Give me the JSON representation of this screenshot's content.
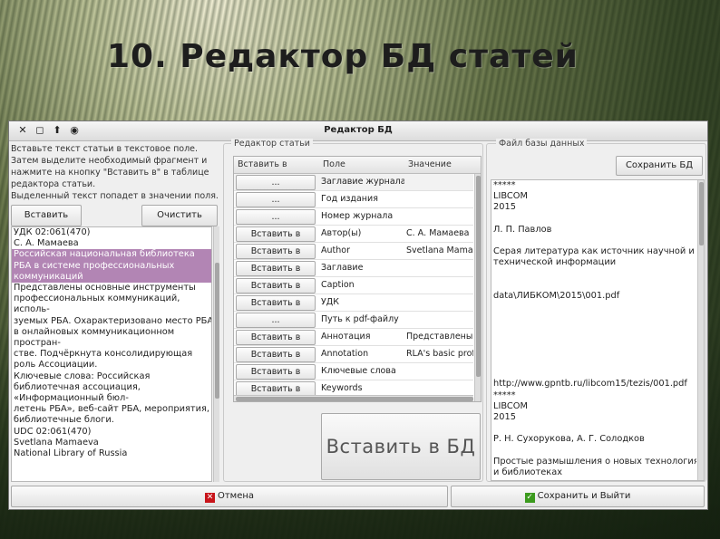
{
  "slide": {
    "title": "10. Редактор БД статей"
  },
  "window": {
    "title": "Редактор БД",
    "controls": [
      "✕",
      "◻",
      "⬆",
      "◉"
    ]
  },
  "left": {
    "instructions": [
      "Вставьте текст статьи в текстовое поле.",
      "Затем выделите необходимый фрагмент и",
      "нажмите на кнопку \"Вставить в\" в таблице",
      "редактора статьи.",
      "Выделенный текст попадет в значении поля."
    ],
    "insert_label": "Вставить",
    "clear_label": "Очистить",
    "text_lines": [
      "УДК 02:061(470)",
      "С. А. Мамаева",
      "Российская национальная библиотека",
      "РБА в системе профессиональных",
      "коммуникаций",
      "Представлены основные инструменты",
      "профессиональных коммуникаций,",
      "исполь-",
      "зуемых РБА. Охарактеризовано место РБА",
      "в онлайновых коммуникационном",
      "простран-",
      "стве. Подчёркнута консолидирующая",
      "роль Ассоциации.",
      "Ключевые слова: Российская",
      "библиотечная ассоциация,",
      "«Информационный бюл-",
      "летень РБА», веб-сайт РБА, мероприятия,",
      "библиотечные блоги.",
      "UDC 02:061(470)",
      "Svetlana Mamaeva",
      "National Library of Russia"
    ],
    "highlighted_lines": [
      2,
      3,
      4
    ]
  },
  "middle": {
    "group_label": "Редактор статьи",
    "headers": {
      "col1": "Вставить в",
      "col2": "Поле",
      "col3": "Значение"
    },
    "rows": [
      {
        "button": "...",
        "field": "Заглавие журнала",
        "value": ""
      },
      {
        "button": "...",
        "field": "Год издания",
        "value": ""
      },
      {
        "button": "...",
        "field": "Номер журнала",
        "value": ""
      },
      {
        "button": "Вставить в",
        "field": "Автор(ы)",
        "value": "С. А. Мамаева"
      },
      {
        "button": "Вставить в",
        "field": "Author",
        "value": "Svetlana Mamaeva"
      },
      {
        "button": "Вставить в",
        "field": "Заглавие",
        "value": ""
      },
      {
        "button": "Вставить в",
        "field": "Caption",
        "value": ""
      },
      {
        "button": "Вставить в",
        "field": "УДК",
        "value": ""
      },
      {
        "button": "...",
        "field": "Путь к pdf-файлу",
        "value": ""
      },
      {
        "button": "Вставить в",
        "field": "Аннотация",
        "value": "Представлены ос"
      },
      {
        "button": "Вставить в",
        "field": "Annotation",
        "value": "RLA's basic profes"
      },
      {
        "button": "Вставить в",
        "field": "Ключевые слова",
        "value": ""
      },
      {
        "button": "Вставить в",
        "field": "Keywords",
        "value": ""
      },
      {
        "button": "",
        "field": "",
        "value": ""
      }
    ],
    "big_button_label": "Вставить в БД"
  },
  "right": {
    "group_label": "Файл базы данных",
    "save_label": "Сохранить БД",
    "file_lines": [
      "*****",
      "LIBCOM",
      "2015",
      "",
      "Л. П. Павлов",
      "",
      "Серая литература как источник научной и",
      "технической информации",
      "",
      "",
      "data\\ЛИБКОМ\\2015\\001.pdf",
      "",
      "",
      "",
      "",
      "",
      "",
      "",
      "http://www.gpntb.ru/libcom15/tezis/001.pdf",
      "*****",
      "LIBCOM",
      "2015",
      "",
      "Р. Н. Сухорукова, А. Г. Солодков",
      "",
      "Простые размышления о новых технологиях",
      "и библиотеках"
    ]
  },
  "footer": {
    "cancel_label": "Отмена",
    "save_exit_label": "Сохранить и Выйти"
  },
  "colors": {
    "highlight": "#b285b4",
    "cancel_icon": "#c8141a",
    "ok_icon": "#3c9a1e"
  }
}
